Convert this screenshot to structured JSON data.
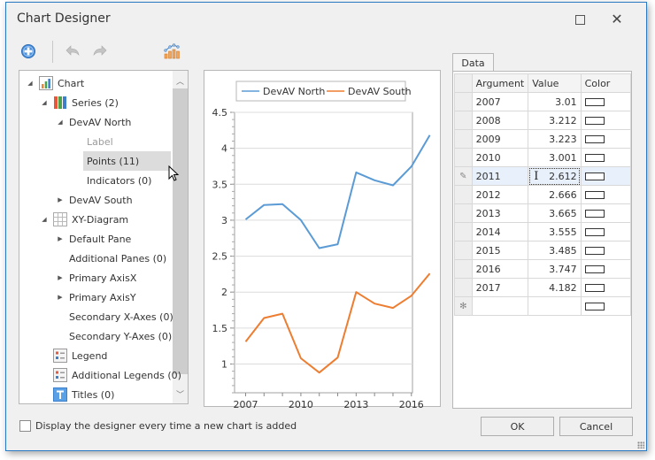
{
  "window": {
    "title": "Chart Designer",
    "maximize_icon": "maximize-icon",
    "close_icon": "close-icon"
  },
  "toolbar": {
    "items": [
      {
        "name": "add-button",
        "icon": "plus-circle-icon",
        "enabled": true
      },
      {
        "name": "undo-button",
        "icon": "undo-icon",
        "enabled": false
      },
      {
        "name": "redo-button",
        "icon": "redo-icon",
        "enabled": false
      },
      {
        "name": "chart-type-button",
        "icon": "chart-type-icon",
        "enabled": true
      }
    ]
  },
  "tree": {
    "items": [
      {
        "label": "Chart",
        "level": 0,
        "toggle": "expanded",
        "icon": "chart-icon"
      },
      {
        "label": "Series (2)",
        "level": 1,
        "toggle": "expanded",
        "icon": "series-icon"
      },
      {
        "label": "DevAV North",
        "level": 2,
        "toggle": "expanded",
        "icon": ""
      },
      {
        "label": "Label",
        "level": 3,
        "toggle": "",
        "icon": "",
        "disabled": true
      },
      {
        "label": "Points (11)",
        "level": 3,
        "toggle": "",
        "icon": "",
        "selected": true
      },
      {
        "label": "Indicators (0)",
        "level": 3,
        "toggle": "",
        "icon": ""
      },
      {
        "label": "DevAV South",
        "level": 2,
        "toggle": "collapsed",
        "icon": ""
      },
      {
        "label": "XY-Diagram",
        "level": 1,
        "toggle": "expanded",
        "icon": "diagram-icon"
      },
      {
        "label": "Default Pane",
        "level": 2,
        "toggle": "collapsed",
        "icon": ""
      },
      {
        "label": "Additional Panes (0)",
        "level": 2,
        "toggle": "",
        "icon": ""
      },
      {
        "label": "Primary AxisX",
        "level": 2,
        "toggle": "collapsed",
        "icon": ""
      },
      {
        "label": "Primary AxisY",
        "level": 2,
        "toggle": "collapsed",
        "icon": ""
      },
      {
        "label": "Secondary X-Axes (0)",
        "level": 2,
        "toggle": "",
        "icon": ""
      },
      {
        "label": "Secondary Y-Axes (0)",
        "level": 2,
        "toggle": "",
        "icon": ""
      },
      {
        "label": "Legend",
        "level": 1,
        "toggle": "",
        "icon": "legend-icon"
      },
      {
        "label": "Additional Legends (0)",
        "level": 1,
        "toggle": "",
        "icon": "legend-icon"
      },
      {
        "label": "Titles (0)",
        "level": 1,
        "toggle": "",
        "icon": "titles-icon"
      }
    ]
  },
  "chart_data": {
    "type": "line",
    "title": "",
    "xlabel": "",
    "ylabel": "",
    "x": [
      2007,
      2008,
      2009,
      2010,
      2011,
      2012,
      2013,
      2014,
      2015,
      2016,
      2017
    ],
    "series": [
      {
        "name": "DevAV North",
        "color": "#5b9bd5",
        "values": [
          3.01,
          3.212,
          3.223,
          3.001,
          2.612,
          2.666,
          3.665,
          3.555,
          3.485,
          3.747,
          4.182
        ]
      },
      {
        "name": "DevAV South",
        "color": "#ed7d31",
        "values": [
          1.31,
          1.64,
          1.7,
          1.08,
          0.88,
          1.09,
          2.0,
          1.84,
          1.78,
          1.95,
          2.26
        ]
      }
    ],
    "xticks": [
      "2007",
      "2010",
      "2013",
      "2016"
    ],
    "yticks": [
      "1",
      "1.5",
      "2",
      "2.5",
      "3",
      "3.5",
      "4",
      "4.5"
    ],
    "ylim": [
      0.6,
      4.5
    ],
    "xlim": [
      2006.4,
      2017.5
    ],
    "grid": true,
    "legend": "top-center"
  },
  "data_grid": {
    "tab_label": "Data",
    "columns": [
      "Argument",
      "Value",
      "Color"
    ],
    "rows": [
      {
        "argument": "2007",
        "value": "3.01"
      },
      {
        "argument": "2008",
        "value": "3.212"
      },
      {
        "argument": "2009",
        "value": "3.223"
      },
      {
        "argument": "2010",
        "value": "3.001"
      },
      {
        "argument": "2011",
        "value": "2.612",
        "focused": true
      },
      {
        "argument": "2012",
        "value": "2.666"
      },
      {
        "argument": "2013",
        "value": "3.665"
      },
      {
        "argument": "2014",
        "value": "3.555"
      },
      {
        "argument": "2015",
        "value": "3.485"
      },
      {
        "argument": "2016",
        "value": "3.747"
      },
      {
        "argument": "2017",
        "value": "4.182"
      }
    ],
    "new_row_indicator": "✻",
    "edit_indicator": "✎"
  },
  "footer": {
    "checkbox_label": "Display the designer every time a new chart is added",
    "checkbox_checked": false,
    "ok_label": "OK",
    "cancel_label": "Cancel"
  }
}
